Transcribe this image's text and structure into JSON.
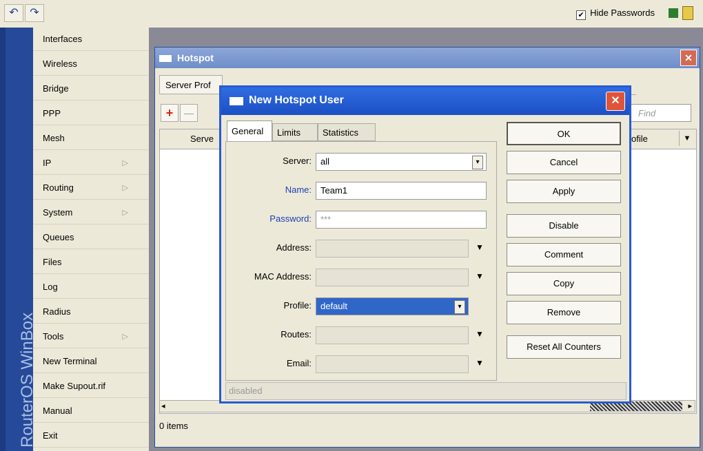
{
  "toolbar": {
    "undo_icon": "↶",
    "redo_icon": "↷",
    "hide_passwords_label": "Hide Passwords",
    "hide_passwords_checked": "✔"
  },
  "brand": {
    "text": "RouterOS WinBox"
  },
  "menu": {
    "items": [
      {
        "label": "Interfaces",
        "submenu": ""
      },
      {
        "label": "Wireless",
        "submenu": ""
      },
      {
        "label": "Bridge",
        "submenu": ""
      },
      {
        "label": "PPP",
        "submenu": ""
      },
      {
        "label": "Mesh",
        "submenu": ""
      },
      {
        "label": "IP",
        "submenu": "▷"
      },
      {
        "label": "Routing",
        "submenu": "▷"
      },
      {
        "label": "System",
        "submenu": "▷"
      },
      {
        "label": "Queues",
        "submenu": ""
      },
      {
        "label": "Files",
        "submenu": ""
      },
      {
        "label": "Log",
        "submenu": ""
      },
      {
        "label": "Radius",
        "submenu": ""
      },
      {
        "label": "Tools",
        "submenu": "▷"
      },
      {
        "label": "New Terminal",
        "submenu": ""
      },
      {
        "label": "Make Supout.rif",
        "submenu": ""
      },
      {
        "label": "Manual",
        "submenu": ""
      },
      {
        "label": "Exit",
        "submenu": ""
      }
    ]
  },
  "hotspot": {
    "title": "Hotspot",
    "close_icon": "✕",
    "tab_server_profiles": "Server Prof",
    "add_icon": "+",
    "remove_icon": "—",
    "find_placeholder": "Find",
    "col_server": "Serve",
    "col_profile": "ofile",
    "col_dropdown_icon": "▼",
    "scroll_left_icon": "◂",
    "scroll_right_icon": "▸",
    "status": "0 items"
  },
  "dialog": {
    "title": "New Hotspot User",
    "close_icon": "✕",
    "tabs": [
      "General",
      "Limits",
      "Statistics"
    ],
    "fields": {
      "server_label": "Server:",
      "server_value": "all",
      "name_label": "Name:",
      "name_value": "Team1",
      "password_label": "Password:",
      "password_value": "***",
      "address_label": "Address:",
      "address_value": "",
      "mac_label": "MAC Address:",
      "mac_value": "",
      "profile_label": "Profile:",
      "profile_value": "default",
      "routes_label": "Routes:",
      "routes_value": "",
      "email_label": "Email:",
      "email_value": ""
    },
    "dropdown_icon": "▼",
    "select_icon": "▾",
    "buttons": {
      "ok": "OK",
      "cancel": "Cancel",
      "apply": "Apply",
      "disable": "Disable",
      "comment": "Comment",
      "copy": "Copy",
      "remove": "Remove",
      "reset_counters": "Reset All Counters"
    },
    "status": "disabled"
  }
}
